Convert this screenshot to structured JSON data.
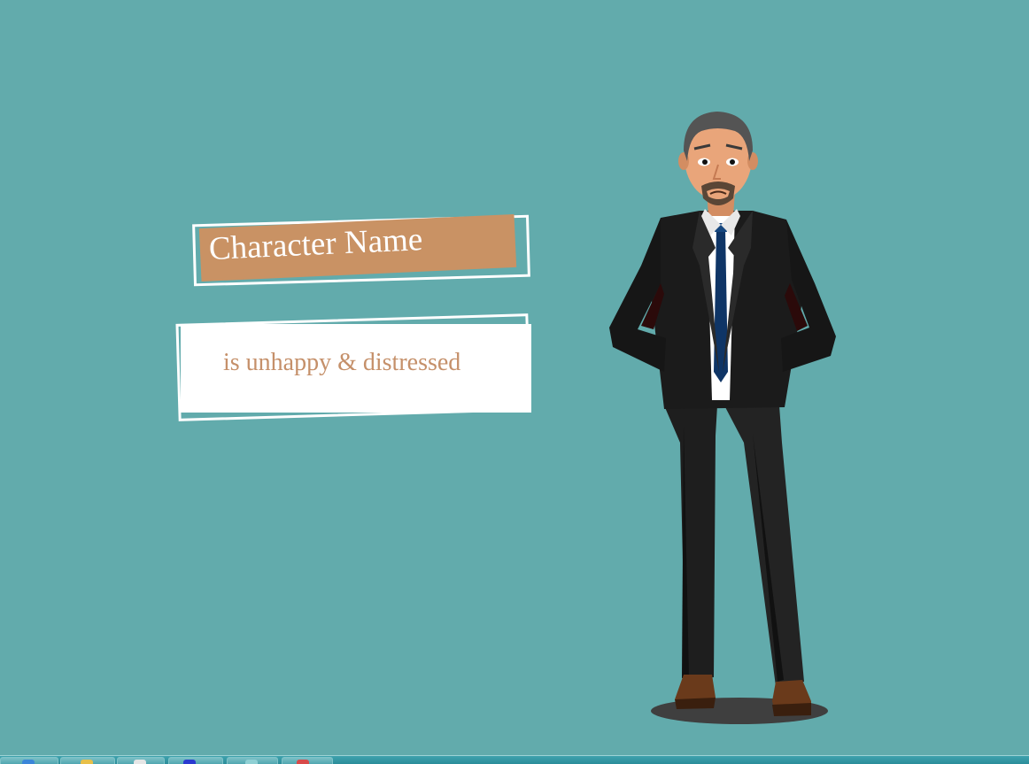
{
  "slide": {
    "background_color": "#62abac",
    "name_card": {
      "label": "Character Name",
      "plate_color": "#c99264",
      "text_color": "#ffffff"
    },
    "status_card": {
      "label": "is unhappy & distressed",
      "text_color": "#c5906a"
    },
    "character": {
      "icon": "businessman-character-icon",
      "suit_color": "#1b1b1b",
      "tie_color": "#0f3566",
      "skin_color": "#e9a57a",
      "shoe_color": "#6a3a1b"
    }
  },
  "taskbar": {
    "buttons": [
      {
        "name": "start-orb",
        "icon": "windows-orb-icon"
      },
      {
        "name": "taskbar-item-explorer",
        "icon": "folder-icon"
      },
      {
        "name": "taskbar-item-notepad",
        "icon": "document-icon"
      },
      {
        "name": "taskbar-item-paint",
        "icon": "paint-icon"
      },
      {
        "name": "taskbar-item-app",
        "icon": "window-icon"
      },
      {
        "name": "taskbar-item-presenter",
        "icon": "red-app-icon"
      }
    ]
  }
}
